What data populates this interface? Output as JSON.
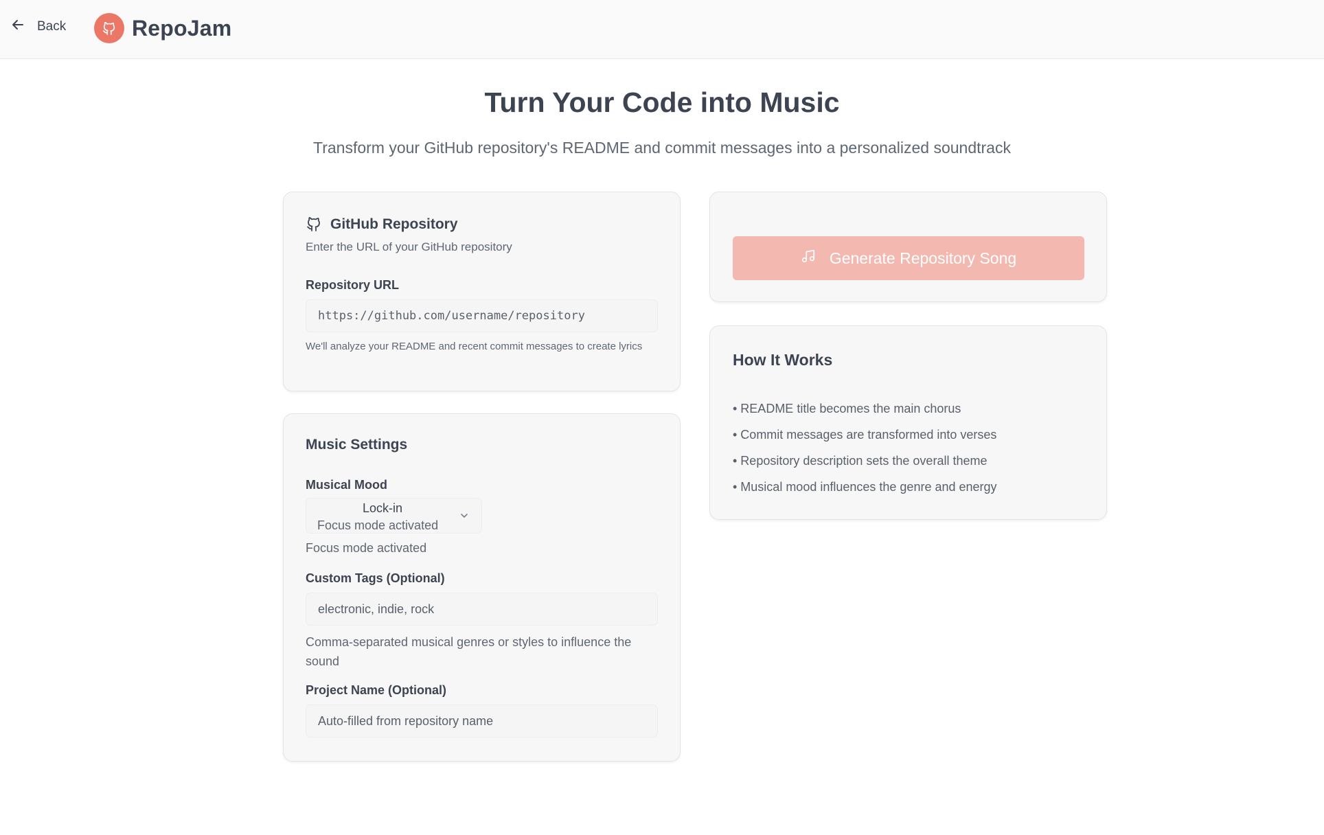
{
  "header": {
    "back_label": "Back",
    "brand_name": "RepoJam",
    "back_icon": "arrow-left-icon",
    "logo_icon": "github-icon",
    "brand_color": "#ec7766"
  },
  "hero": {
    "title": "Turn Your Code into Music",
    "subtitle": "Transform your GitHub repository's README and commit messages into a personalized soundtrack"
  },
  "github_card": {
    "title": "GitHub Repository",
    "description": "Enter the URL of your GitHub repository",
    "url_label": "Repository URL",
    "url_placeholder": "https://github.com/username/repository",
    "url_value": "",
    "hint": "We'll analyze your README and recent commit messages to create lyrics"
  },
  "music_card": {
    "title": "Music Settings",
    "mood_label": "Musical Mood",
    "mood_selected": "Lock-in",
    "mood_selected_sub": "Focus mode activated",
    "mood_description": "Focus mode activated",
    "tags_label": "Custom Tags (Optional)",
    "tags_placeholder": "electronic, indie, rock",
    "tags_value": "",
    "tags_hint": "Comma-separated musical genres or styles to influence the sound",
    "project_label": "Project Name (Optional)",
    "project_placeholder": "Auto-filled from repository name",
    "project_value": ""
  },
  "generate": {
    "button_label": "Generate Repository Song",
    "button_icon": "music-note-icon",
    "button_color": "#f3b8b0",
    "disabled": true
  },
  "how_it_works": {
    "title": "How It Works",
    "items": [
      "• README title becomes the main chorus",
      "• Commit messages are transformed into verses",
      "• Repository description sets the overall theme",
      "• Musical mood influences the genre and energy"
    ]
  }
}
